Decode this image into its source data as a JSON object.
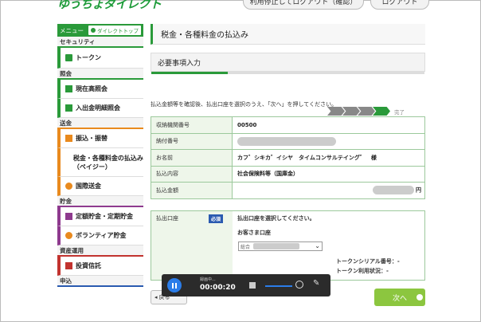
{
  "header": {
    "logo": "ゆうちょダイレクト",
    "stop_logout_label": "利用停止してログアウト（確認）",
    "logout_label": "ログアウト"
  },
  "sidebar": {
    "menu_label": "メニュー",
    "direct_top_label": "ダイレクトトップ",
    "sections": [
      {
        "label": "セキュリティ",
        "color": "#2a9a3a"
      },
      {
        "label": "照会",
        "color": "#2a9a3a"
      },
      {
        "label": "送金",
        "color": "#e98a1e"
      },
      {
        "label": "貯金",
        "color": "#8e3a8e"
      },
      {
        "label": "資産運用",
        "color": "#c2332f"
      },
      {
        "label": "申込",
        "color": "#2a5ab0"
      }
    ],
    "items": [
      {
        "label": "トークン",
        "icon": "token-icon"
      },
      {
        "label": "現在高照会",
        "icon": "balance-icon"
      },
      {
        "label": "入出金明細照会",
        "icon": "statement-icon"
      },
      {
        "label": "振込・振替",
        "icon": "transfer-icon"
      },
      {
        "label": "税金・各種料金の払込み（ペイジー）",
        "icon": "payment-icon"
      },
      {
        "label": "国際送金",
        "icon": "globe-icon"
      },
      {
        "label": "定額貯金・定期貯金",
        "icon": "savings-icon"
      },
      {
        "label": "ボランティア貯金",
        "icon": "volunteer-icon"
      },
      {
        "label": "投資信託",
        "icon": "investment-icon"
      }
    ]
  },
  "main": {
    "page_title": "税金・各種料金の払込み",
    "section_title": "必要事項入力",
    "step_done_label": "完了",
    "instruction": "払込金額等を確認後、払出口座を選択のうえ、「次へ」を押してください。",
    "rows": [
      {
        "key": "収納機関番号",
        "value": "00500"
      },
      {
        "key": "納付番号",
        "value": ""
      },
      {
        "key": "お名前",
        "value": "カフ゛シキカ゛イシヤ　タイムコンサルテイング゛　様"
      },
      {
        "key": "払込内容",
        "value": "社会保険料等（国庫金）"
      },
      {
        "key": "払込金額",
        "value": "円"
      }
    ],
    "account": {
      "label": "払出口座",
      "required_label": "必須",
      "prompt": "払出口座を選択してください。",
      "customer_account_label": "お客さま口座",
      "select_value": "総合",
      "token_serial_label": "トークンシリアル番号：-",
      "token_status_label": "トークン利用状況：-"
    },
    "back_label": "戻る",
    "next_label": "次へ"
  },
  "recorder": {
    "state_label": "録画中...",
    "time": "00:00:20"
  }
}
